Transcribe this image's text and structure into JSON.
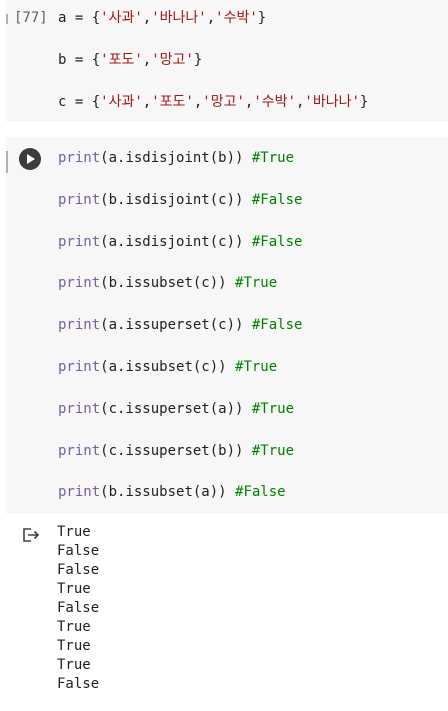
{
  "cell1": {
    "execution_count": "[77]",
    "lines": [
      {
        "var": "a",
        "eq": " = ",
        "open": "{",
        "items": [
          "'사과'",
          "'바나나'",
          "'수박'"
        ],
        "close": "}"
      },
      {
        "var": "b",
        "eq": " = ",
        "open": "{",
        "items": [
          "'포도'",
          "'망고'"
        ],
        "close": "}"
      },
      {
        "var": "c",
        "eq": " = ",
        "open": "{",
        "items": [
          "'사과'",
          "'포도'",
          "'망고'",
          "'수박'",
          "'바나나'"
        ],
        "close": "}"
      }
    ]
  },
  "cell2": {
    "run_icon": "play-circle-icon",
    "lines": [
      {
        "fn": "print",
        "args": "(a.isdisjoint(b))",
        "comment": "#True"
      },
      {
        "fn": "print",
        "args": "(b.isdisjoint(c))",
        "comment": "#False"
      },
      {
        "fn": "print",
        "args": "(a.isdisjoint(c))",
        "comment": "#False"
      },
      {
        "fn": "print",
        "args": "(b.issubset(c))",
        "comment": "#True"
      },
      {
        "fn": "print",
        "args": "(a.issuperset(c))",
        "comment": "#False"
      },
      {
        "fn": "print",
        "args": "(a.issubset(c))",
        "comment": "#True"
      },
      {
        "fn": "print",
        "args": "(c.issuperset(a))",
        "comment": "#True"
      },
      {
        "fn": "print",
        "args": "(c.issuperset(b))",
        "comment": "#True"
      },
      {
        "fn": "print",
        "args": "(b.issubset(a))",
        "comment": "#False"
      }
    ]
  },
  "output": {
    "icon": "output-redirect-icon",
    "lines": [
      "True",
      "False",
      "False",
      "True",
      "False",
      "True",
      "True",
      "True",
      "False"
    ]
  }
}
